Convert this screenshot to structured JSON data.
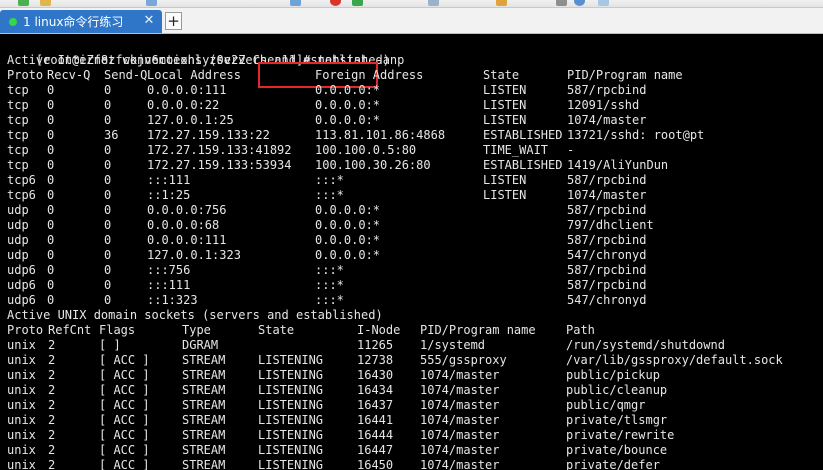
{
  "tab": {
    "label": "1 linux命令行练习",
    "close_glyph": "✕"
  },
  "new_tab_glyph": "+",
  "prompt": "[root@iZf8zfwkjv6moexhlyz0v2Z Chen11]# ",
  "command": "netstat -anp",
  "inet_heading": "Active Internet connections (servers and established)",
  "inet_columns": [
    "Proto",
    "Recv-Q",
    "Send-Q",
    "Local Address",
    "Foreign Address",
    "State",
    "PID/Program name"
  ],
  "inet_rows": [
    [
      "tcp",
      "0",
      "0",
      "0.0.0.0:111",
      "0.0.0.0:*",
      "LISTEN",
      "587/rpcbind"
    ],
    [
      "tcp",
      "0",
      "0",
      "0.0.0.0:22",
      "0.0.0.0:*",
      "LISTEN",
      "12091/sshd"
    ],
    [
      "tcp",
      "0",
      "0",
      "127.0.0.1:25",
      "0.0.0.0:*",
      "LISTEN",
      "1074/master"
    ],
    [
      "tcp",
      "0",
      "36",
      "172.27.159.133:22",
      "113.81.101.86:4868",
      "ESTABLISHED",
      "13721/sshd: root@pt"
    ],
    [
      "tcp",
      "0",
      "0",
      "172.27.159.133:41892",
      "100.100.0.5:80",
      "TIME_WAIT",
      "-"
    ],
    [
      "tcp",
      "0",
      "0",
      "172.27.159.133:53934",
      "100.100.30.26:80",
      "ESTABLISHED",
      "1419/AliYunDun"
    ],
    [
      "tcp6",
      "0",
      "0",
      ":::111",
      ":::*",
      "LISTEN",
      "587/rpcbind"
    ],
    [
      "tcp6",
      "0",
      "0",
      "::1:25",
      ":::*",
      "LISTEN",
      "1074/master"
    ],
    [
      "udp",
      "0",
      "0",
      "0.0.0.0:756",
      "0.0.0.0:*",
      "",
      "587/rpcbind"
    ],
    [
      "udp",
      "0",
      "0",
      "0.0.0.0:68",
      "0.0.0.0:*",
      "",
      "797/dhclient"
    ],
    [
      "udp",
      "0",
      "0",
      "0.0.0.0:111",
      "0.0.0.0:*",
      "",
      "587/rpcbind"
    ],
    [
      "udp",
      "0",
      "0",
      "127.0.0.1:323",
      "0.0.0.0:*",
      "",
      "547/chronyd"
    ],
    [
      "udp6",
      "0",
      "0",
      ":::756",
      ":::*",
      "",
      "587/rpcbind"
    ],
    [
      "udp6",
      "0",
      "0",
      ":::111",
      ":::*",
      "",
      "587/rpcbind"
    ],
    [
      "udp6",
      "0",
      "0",
      "::1:323",
      ":::*",
      "",
      "547/chronyd"
    ]
  ],
  "unix_heading": "Active UNIX domain sockets (servers and established)",
  "unix_columns": [
    "Proto",
    "RefCnt",
    "Flags",
    "Type",
    "State",
    "I-Node",
    "PID/Program name",
    "Path"
  ],
  "unix_rows": [
    [
      "unix",
      "2",
      "[ ]",
      "DGRAM",
      "",
      "11265",
      "1/systemd",
      "/run/systemd/shutdownd"
    ],
    [
      "unix",
      "2",
      "[ ACC ]",
      "STREAM",
      "LISTENING",
      "12738",
      "555/gssproxy",
      "/var/lib/gssproxy/default.sock"
    ],
    [
      "unix",
      "2",
      "[ ACC ]",
      "STREAM",
      "LISTENING",
      "16430",
      "1074/master",
      "public/pickup"
    ],
    [
      "unix",
      "2",
      "[ ACC ]",
      "STREAM",
      "LISTENING",
      "16434",
      "1074/master",
      "public/cleanup"
    ],
    [
      "unix",
      "2",
      "[ ACC ]",
      "STREAM",
      "LISTENING",
      "16437",
      "1074/master",
      "public/qmgr"
    ],
    [
      "unix",
      "2",
      "[ ACC ]",
      "STREAM",
      "LISTENING",
      "16441",
      "1074/master",
      "private/tlsmgr"
    ],
    [
      "unix",
      "2",
      "[ ACC ]",
      "STREAM",
      "LISTENING",
      "16444",
      "1074/master",
      "private/rewrite"
    ],
    [
      "unix",
      "2",
      "[ ACC ]",
      "STREAM",
      "LISTENING",
      "16447",
      "1074/master",
      "private/bounce"
    ],
    [
      "unix",
      "2",
      "[ ACC ]",
      "STREAM",
      "LISTENING",
      "16450",
      "1074/master",
      "private/defer"
    ]
  ],
  "colors": {
    "terminal_bg": "#000000",
    "terminal_fg": "#e6e6e6",
    "tab_active": "#2f76c9",
    "tab_status": "#36d64a",
    "highlight": "#e5262b"
  }
}
